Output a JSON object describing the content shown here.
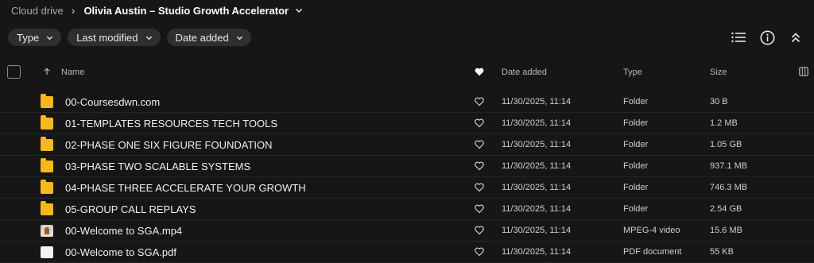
{
  "breadcrumb": {
    "root": "Cloud drive",
    "separator": "›",
    "current": "Olivia Austin – Studio Growth Accelerator"
  },
  "filters": [
    {
      "label": "Type"
    },
    {
      "label": "Last modified"
    },
    {
      "label": "Date added"
    }
  ],
  "actions": [
    "list-view-icon",
    "info-icon",
    "collapse-icon"
  ],
  "columns": {
    "name": "Name",
    "date_added": "Date added",
    "type": "Type",
    "size": "Size"
  },
  "rows": [
    {
      "name": "00-Coursesdwn.com",
      "date": "11/30/2025, 11:14",
      "type": "Folder",
      "size": "30 B",
      "icon": "folder-icon"
    },
    {
      "name": "01-TEMPLATES RESOURCES TECH TOOLS",
      "date": "11/30/2025, 11:14",
      "type": "Folder",
      "size": "1.2 MB",
      "icon": "folder-icon"
    },
    {
      "name": "02-PHASE ONE SIX FIGURE FOUNDATION",
      "date": "11/30/2025, 11:14",
      "type": "Folder",
      "size": "1.05 GB",
      "icon": "folder-icon"
    },
    {
      "name": "03-PHASE TWO SCALABLE SYSTEMS",
      "date": "11/30/2025, 11:14",
      "type": "Folder",
      "size": "937.1 MB",
      "icon": "folder-icon"
    },
    {
      "name": "04-PHASE THREE ACCELERATE YOUR GROWTH",
      "date": "11/30/2025, 11:14",
      "type": "Folder",
      "size": "746.3 MB",
      "icon": "folder-icon"
    },
    {
      "name": "05-GROUP CALL REPLAYS",
      "date": "11/30/2025, 11:14",
      "type": "Folder",
      "size": "2.54 GB",
      "icon": "folder-icon"
    },
    {
      "name": "00-Welcome to SGA.mp4",
      "date": "11/30/2025, 11:14",
      "type": "MPEG-4 video",
      "size": "15.6 MB",
      "icon": "video-thumbnail-icon"
    },
    {
      "name": "00-Welcome to SGA.pdf",
      "date": "11/30/2025, 11:14",
      "type": "PDF document",
      "size": "55 KB",
      "icon": "pdf-thumbnail-icon"
    }
  ]
}
